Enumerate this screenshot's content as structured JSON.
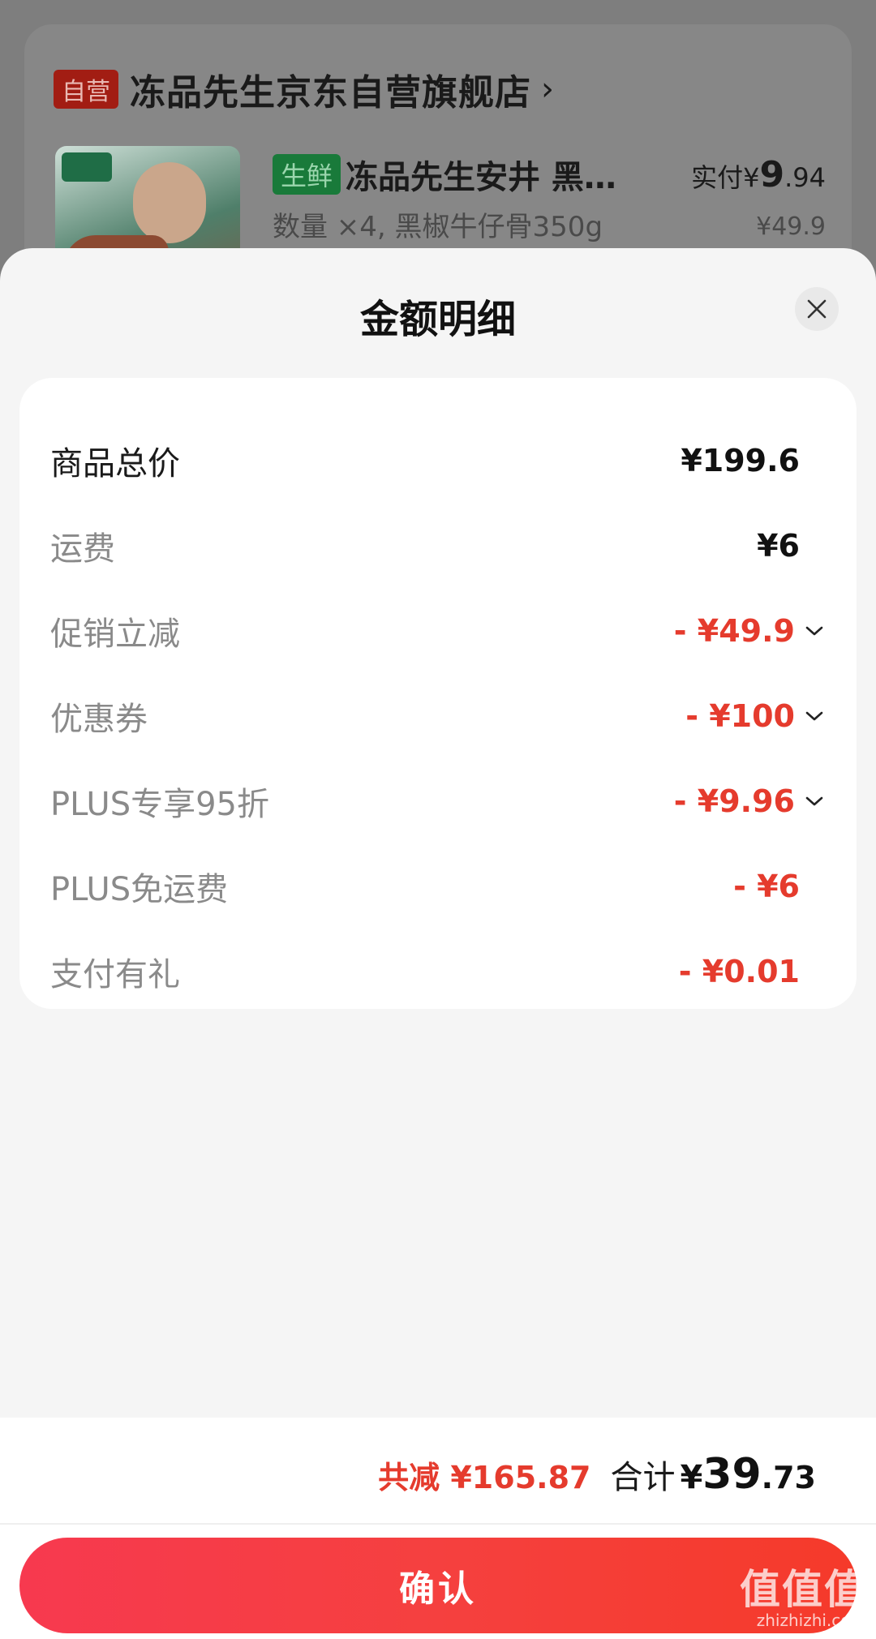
{
  "background_order": {
    "self_operated_badge": "自营",
    "store_name": "冻品先生京东自营旗舰店",
    "store_arrow": "›",
    "fresh_tag": "生鲜",
    "product_title": "冻品先生安井 黑…",
    "product_spec": "数量 ×4, 黑椒牛仔骨350g",
    "paid_label": "实付",
    "paid_yen": "¥",
    "paid_int": "9",
    "paid_dec": ".94",
    "original_price": "¥49.9"
  },
  "sheet": {
    "title": "金额明细",
    "close_icon": "close-icon"
  },
  "details": [
    {
      "label": "商品总价",
      "value": "¥199.6",
      "emphasis": "dark",
      "expandable": false
    },
    {
      "label": "运费",
      "value": "¥6",
      "emphasis": "normal",
      "expandable": false
    },
    {
      "label": "促销立减",
      "value": "- ¥49.9",
      "emphasis": "discount",
      "expandable": true
    },
    {
      "label": "优惠券",
      "value": "- ¥100",
      "emphasis": "discount",
      "expandable": true
    },
    {
      "label": "PLUS专享95折",
      "value": "- ¥9.96",
      "emphasis": "discount",
      "expandable": true
    },
    {
      "label": "PLUS免运费",
      "value": "- ¥6",
      "emphasis": "discount",
      "expandable": false
    },
    {
      "label": "支付有礼",
      "value": "- ¥0.01",
      "emphasis": "discount",
      "expandable": false
    }
  ],
  "footer": {
    "saved_text": "共减 ¥165.87",
    "total_label": "合计",
    "total_yen": "¥",
    "total_int": "39",
    "total_dec": ".73",
    "confirm_label": "确认"
  },
  "watermark": {
    "big": "值值值",
    "small": "zhizhizhi.com"
  },
  "colors": {
    "accent_red": "#e53b2d",
    "button_gradient_start": "#f7394f",
    "button_gradient_end": "#f53a2a"
  }
}
